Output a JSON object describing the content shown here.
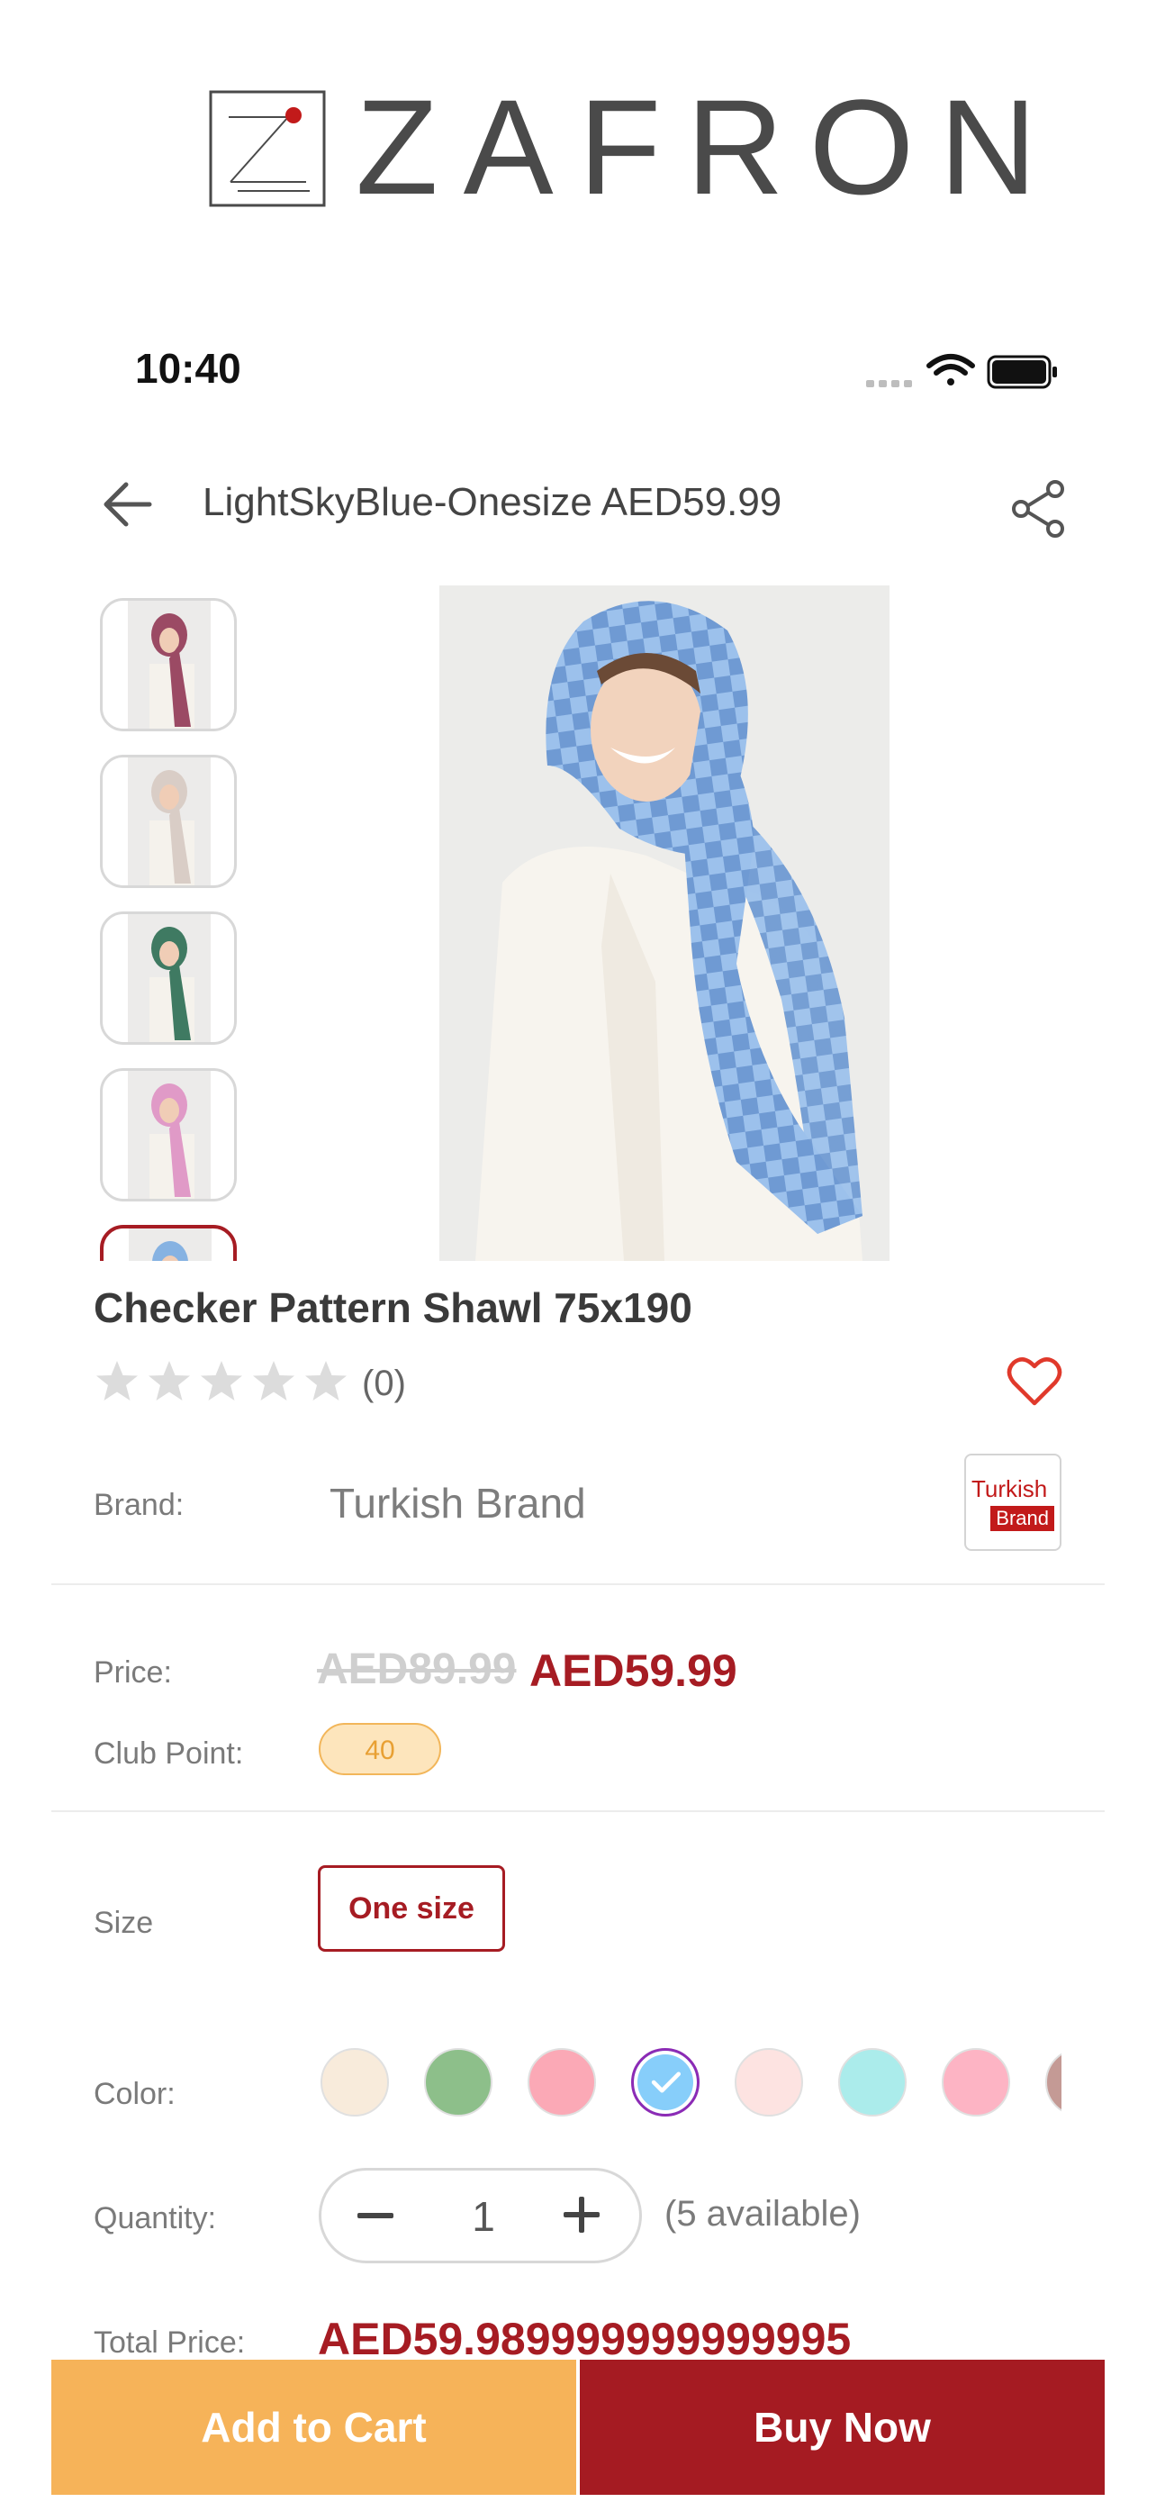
{
  "brand_banner": {
    "name": "ZAFRON",
    "logo_icon": "zafron-logo-icon",
    "accent": "#c21a1a"
  },
  "status_bar": {
    "time": "10:40"
  },
  "header": {
    "title": "LightSkyBlue-Onesize AED59.99",
    "back_icon": "arrow-left-icon",
    "share_icon": "share-icon"
  },
  "gallery": {
    "thumbnails": [
      {
        "scarf_color": "#9b4a64"
      },
      {
        "scarf_color": "#d9cdc6"
      },
      {
        "scarf_color": "#3f7a62"
      },
      {
        "scarf_color": "#e09ac7"
      },
      {
        "scarf_color": "#86b2e2",
        "selected": true
      }
    ],
    "main_scarf_color": "#8fb8e8"
  },
  "product": {
    "title": "Checker Pattern Shawl 75x190",
    "rating": 0,
    "review_count": "(0)"
  },
  "brand": {
    "label": "Brand:",
    "value": "Turkish Brand",
    "logo_line1": "Turkish",
    "logo_line2": "Brand"
  },
  "price": {
    "label": "Price:",
    "old": "AED89.99",
    "new": "AED59.99"
  },
  "club_point": {
    "label": "Club Point:",
    "value": "40"
  },
  "size": {
    "label": "Size",
    "option": "One size"
  },
  "color": {
    "label": "Color:",
    "swatches": [
      "#f8ebdb",
      "#8dbf8a",
      "#fba9b6",
      "#87cefa",
      "#fde3e1",
      "#abeceb",
      "#fdb4c4",
      "#c49a95"
    ],
    "selected_index": 3
  },
  "quantity": {
    "label": "Quantity:",
    "value": "1",
    "available": "(5 available)"
  },
  "total": {
    "label": "Total Price:",
    "value": "AED59.989999999999995"
  },
  "actions": {
    "add_to_cart": "Add to Cart",
    "buy_now": "Buy Now"
  }
}
